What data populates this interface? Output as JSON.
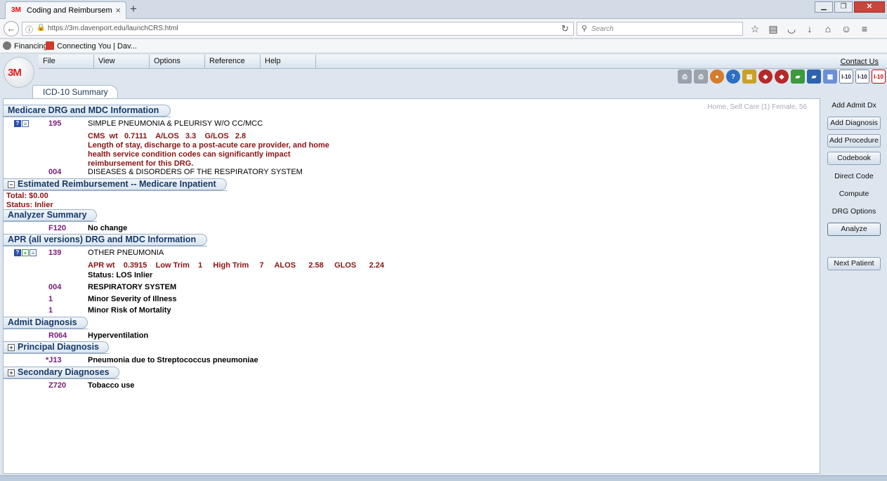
{
  "browser": {
    "tab_favicon": "3M",
    "tab_title": "Coding and Reimburseme...",
    "tab_close": "×",
    "new_tab": "+",
    "url": "https://3m.davenport.edu/launchCRS.html",
    "search_placeholder": "Search",
    "bookmarks": [
      {
        "label": "Financing",
        "icon": "globe-icon"
      },
      {
        "label": "Connecting You | Dav...",
        "icon": "davenport-icon"
      }
    ]
  },
  "app": {
    "logo": "3M",
    "menu": [
      {
        "label": "File"
      },
      {
        "label": "View"
      },
      {
        "label": "Options"
      },
      {
        "label": "Reference"
      },
      {
        "label": "Help"
      }
    ],
    "contact": "Contact Us",
    "tool_icons": [
      "I-10",
      "I-10",
      "I-10"
    ],
    "summary_tab": "ICD-10 Summary",
    "patient_hint": "Home, Self Care (1)  Female, 56"
  },
  "medicare_drg": {
    "header": "Medicare DRG and MDC Information",
    "drg_code": "195",
    "drg_desc": "SIMPLE PNEUMONIA & PLEURISY W/O CC/MCC",
    "weights": "CMS  wt   0.7111    A/LOS   3.3    G/LOS   2.8",
    "note": "Length of stay, discharge to a post-acute care provider, and home health service condition codes can significantly impact reimbursement for this DRG.",
    "mdc_code": "004",
    "mdc_desc": "DISEASES & DISORDERS OF THE RESPIRATORY SYSTEM"
  },
  "reimbursement": {
    "header": "Estimated Reimbursement -- Medicare Inpatient",
    "toggle": "−",
    "total": "Total:  $0.00",
    "status": "Status: Inlier"
  },
  "analyzer": {
    "header": "Analyzer Summary",
    "code": "F120",
    "desc": "No change"
  },
  "apr_drg": {
    "header": "APR (all versions) DRG and MDC Information",
    "drg_code": "139",
    "drg_desc": "OTHER PNEUMONIA",
    "weights": "APR wt    0.3915    Low Trim    1     High Trim     7     ALOS      2.58     GLOS      2.24",
    "status": "Status: LOS Inlier",
    "mdc_code": "004",
    "mdc_desc": "RESPIRATORY SYSTEM",
    "soi_code": "1",
    "soi_desc": "Minor Severity of Illness",
    "rom_code": "1",
    "rom_desc": "Minor Risk of Mortality"
  },
  "admit_dx": {
    "header": "Admit Diagnosis",
    "code": "R064",
    "desc": "Hyperventilation"
  },
  "principal_dx": {
    "header": "Principal Diagnosis",
    "toggle": "+",
    "code": "*J13",
    "desc": "Pneumonia due to Streptococcus pneumoniae"
  },
  "secondary_dx": {
    "header": "Secondary Diagnoses",
    "toggle": "+",
    "code": "Z720",
    "desc": "Tobacco use"
  },
  "buttons": {
    "add_admit_dx": "Add Admit Dx",
    "add_diagnosis": "Add Diagnosis",
    "add_procedure": "Add Procedure",
    "codebook": "Codebook",
    "direct_code": "Direct Code",
    "compute": "Compute",
    "drg_options": "DRG Options",
    "analyze": "Analyze",
    "next_patient": "Next Patient"
  }
}
